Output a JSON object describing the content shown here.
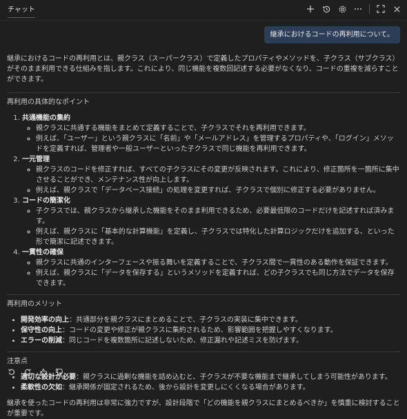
{
  "header": {
    "tab": "チャット",
    "icons": [
      "plus-icon",
      "history-icon",
      "gear-icon",
      "more-icon",
      "maximize-icon",
      "close-icon"
    ]
  },
  "user_message": "継承におけるコードの再利用について。",
  "intro": "継承におけるコードの再利用とは、親クラス（スーパークラス）で定義したプロパティやメソッドを、子クラス（サブクラス）がそのまま利用できる仕組みを指します。これにより、同じ機能を複数回記述する必要がなくなり、コードの重複を減らすことができます。",
  "section1": {
    "title": "再利用の具体的なポイント",
    "items": [
      {
        "title": "共通機能の集約",
        "subs": [
          "親クラスに共通する機能をまとめて定義することで、子クラスでそれを再利用できます。",
          "例えば、「ユーザー」という親クラスに「名前」や「メールアドレス」を管理するプロパティや、「ログイン」メソッドを定義すれば、管理者や一般ユーザーといった子クラスで同じ機能を再利用できます。"
        ]
      },
      {
        "title": "一元管理",
        "subs": [
          "親クラスのコードを修正すれば、すべての子クラスにその変更が反映されます。これにより、修正箇所を一箇所に集中させることができ、メンテナンス性が向上します。",
          "例えば、親クラスで「データベース接続」の処理を変更すれば、子クラスで個別に修正する必要がありません。"
        ]
      },
      {
        "title": "コードの簡潔化",
        "subs": [
          "子クラスでは、親クラスから継承した機能をそのまま利用できるため、必要最低限のコードだけを記述すれば済みます。",
          "例えば、親クラスに「基本的な計算機能」を定義し、子クラスでは特化した計算ロジックだけを追加する、といった形で簡潔に記述できます。"
        ]
      },
      {
        "title": "一貫性の確保",
        "subs": [
          "親クラスに共通のインターフェースや振る舞いを定義することで、子クラス間で一貫性のある動作を保証できます。",
          "例えば、親クラスに「データを保存する」というメソッドを定義すれば、どの子クラスでも同じ方法でデータを保存できます。"
        ]
      }
    ]
  },
  "section2": {
    "title": "再利用のメリット",
    "items": [
      {
        "label": "開発効率の向上",
        "text": "：共通部分を親クラスにまとめることで、子クラスの実装に集中できます。"
      },
      {
        "label": "保守性の向上",
        "text": "：コードの変更や修正が親クラスに集約されるため、影響範囲を把握しやすくなります。"
      },
      {
        "label": "エラーの削減",
        "text": "：同じコードを複数箇所に記述しないため、修正漏れや記述ミスを防げます。"
      }
    ]
  },
  "section3": {
    "title": "注意点",
    "items": [
      {
        "label": "適切な設計が必要",
        "text": "：親クラスに過剰な機能を詰め込むと、子クラスが不要な機能まで継承してしまう可能性があります。"
      },
      {
        "label": "柔軟性の欠如",
        "text": "：継承関係が固定されるため、後から設計を変更しにくくなる場合があります。"
      }
    ]
  },
  "conclusion": "継承を使ったコードの再利用は非常に強力ですが、設計段階で「どの機能を親クラスにまとめるべきか」を慎重に検討することが重要です。",
  "feedback_icons": [
    "copy-icon",
    "retry-icon",
    "thumbs-up-icon",
    "thumbs-down-icon"
  ]
}
